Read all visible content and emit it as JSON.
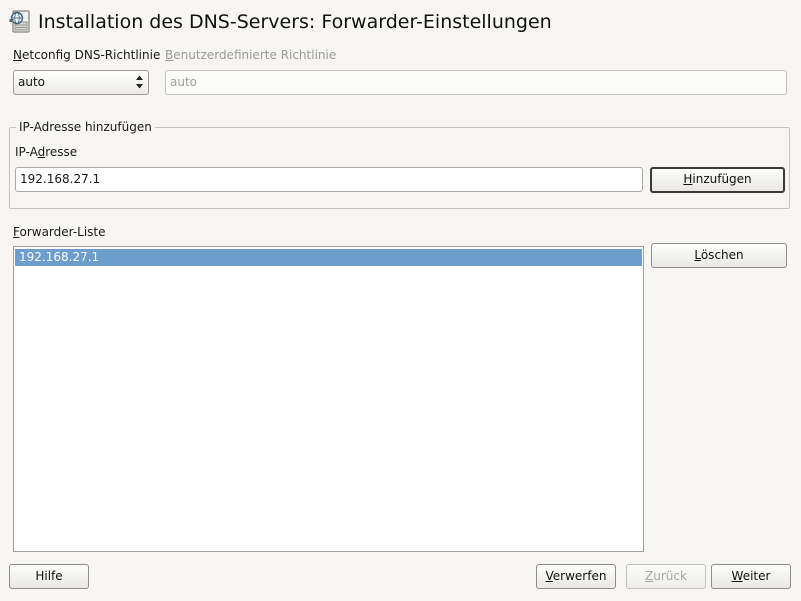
{
  "window": {
    "title": "Installation des DNS-Servers: Forwarder-Einstellungen",
    "icon": "dns-server-app-icon"
  },
  "netconfig": {
    "label_pre": "",
    "label_key": "N",
    "label_post": "etconfig DNS-Richtlinie",
    "selected": "auto"
  },
  "custom_policy": {
    "label_pre": "",
    "label_key": "B",
    "label_post": "enutzerdefinierte Richtlinie",
    "value": "auto",
    "enabled": false
  },
  "add_group": {
    "legend": "IP-Adresse hinzufügen",
    "ip_label_pre": "IP-A",
    "ip_label_key": "d",
    "ip_label_post": "resse",
    "ip_value": "192.168.27.1",
    "add_button_pre": "",
    "add_button_key": "H",
    "add_button_post": "inzufügen"
  },
  "forwarders": {
    "label_pre": "",
    "label_key": "F",
    "label_post": "orwarder-Liste",
    "items": [
      "192.168.27.1"
    ],
    "selected_index": 0,
    "delete_button_pre": "",
    "delete_button_key": "L",
    "delete_button_post": "öschen"
  },
  "footer": {
    "help": "Hilfe",
    "discard_pre": "",
    "discard_key": "V",
    "discard_post": "erwerfen",
    "back_pre": "",
    "back_key": "Z",
    "back_post": "urück",
    "next_pre": "",
    "next_key": "W",
    "next_post": "eiter"
  },
  "colors": {
    "selection": "#6d9dcc",
    "background": "#f7f6f2"
  }
}
